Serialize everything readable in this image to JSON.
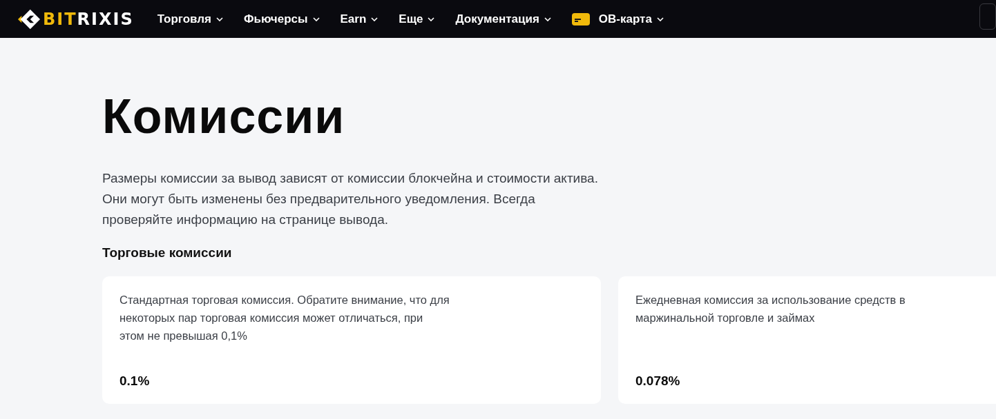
{
  "header": {
    "logo": {
      "accent": "BIT",
      "rest": "RIXIS"
    },
    "nav": [
      {
        "label": "Торговля",
        "kind": "menu"
      },
      {
        "label": "Фьючерсы",
        "kind": "menu"
      },
      {
        "label": "Earn",
        "kind": "menu"
      },
      {
        "label": "Еще",
        "kind": "menu"
      },
      {
        "label": "Документация",
        "kind": "menu"
      },
      {
        "label": "OB-карта",
        "kind": "card-menu"
      }
    ]
  },
  "page": {
    "title": "Комиссии",
    "intro": [
      "Размеры комиссии за вывод зависят от комиссии блокчейна и стоимости актива.",
      "Они могут быть изменены без предварительного уведомления. Всегда",
      "проверяйте информацию на странице вывода."
    ],
    "section_title": "Торговые комиссии",
    "cards": [
      {
        "description": [
          "Стандартная торговая комиссия. Обратите внимание, что для",
          "некоторых пар торговая комиссия может отличаться, при",
          "этом не превышая 0,1%"
        ],
        "value": "0.1%"
      },
      {
        "description": [
          "Ежедневная комиссия за использование средств в",
          "маржинальной торговле и займах"
        ],
        "value": "0.078%"
      }
    ]
  }
}
